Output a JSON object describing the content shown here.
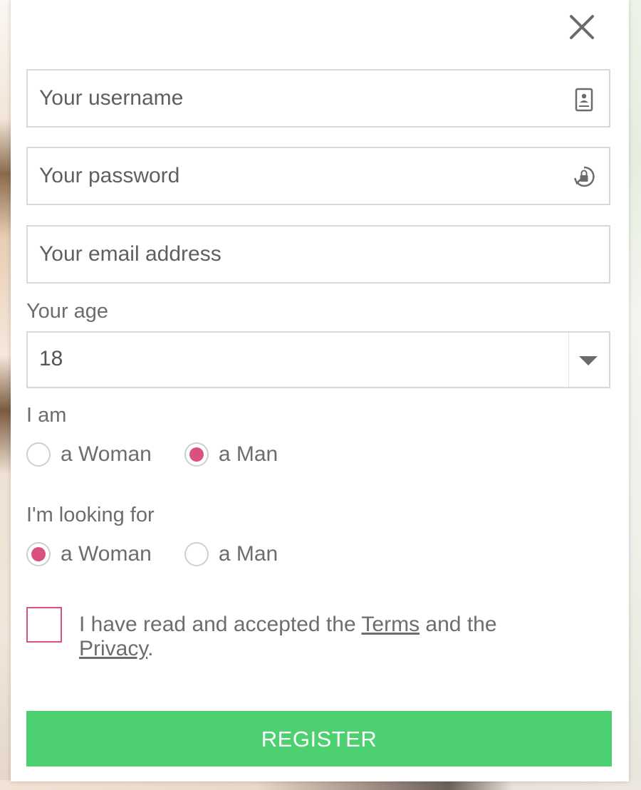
{
  "form": {
    "username": {
      "value": "",
      "placeholder": "Your username",
      "icon": "id-card-icon"
    },
    "password": {
      "value": "",
      "placeholder": "Your password",
      "icon": "lock-refresh-icon"
    },
    "email": {
      "value": "",
      "placeholder": "Your email address"
    },
    "age": {
      "label": "Your age",
      "selected": "18",
      "icon": "caret-down-icon"
    },
    "i_am": {
      "label": "I am",
      "options": [
        {
          "label": "a Woman",
          "checked": false
        },
        {
          "label": "a Man",
          "checked": true
        }
      ]
    },
    "looking_for": {
      "label": "I'm looking for",
      "options": [
        {
          "label": "a Woman",
          "checked": true
        },
        {
          "label": "a Man",
          "checked": false
        }
      ]
    },
    "terms": {
      "checked": false,
      "text_before": "I have read and accepted the ",
      "terms_link": "Terms",
      "text_middle": " and the ",
      "privacy_link": "Privacy",
      "text_after": "."
    },
    "register_label": "REGISTER"
  },
  "colors": {
    "accent": "#d9527f",
    "button": "#4cd070",
    "border": "#d8d8d8",
    "text": "#6d6d6d"
  }
}
